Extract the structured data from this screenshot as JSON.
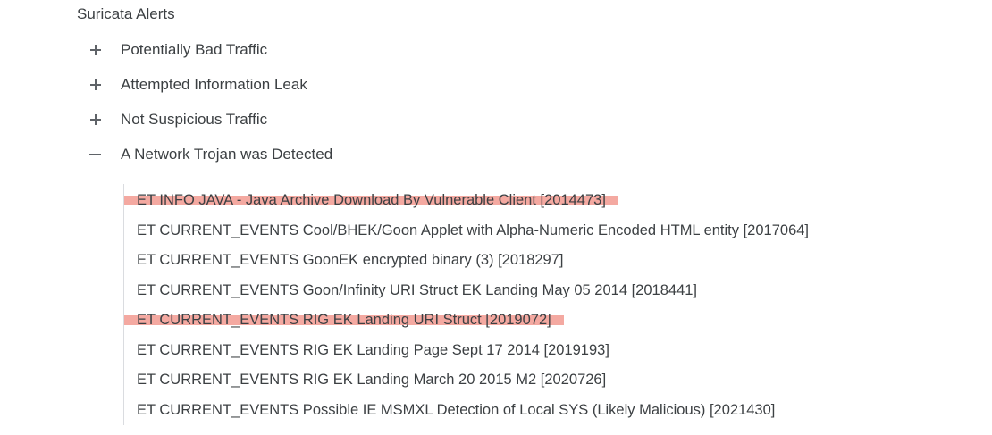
{
  "title": "Suricata Alerts",
  "categories": [
    {
      "label": "Potentially Bad Traffic",
      "state": "collapsed",
      "icon": "plus-icon"
    },
    {
      "label": "Attempted Information Leak",
      "state": "collapsed",
      "icon": "plus-icon"
    },
    {
      "label": "Not Suspicious Traffic",
      "state": "collapsed",
      "icon": "plus-icon"
    },
    {
      "label": "A Network Trojan was Detected",
      "state": "expanded",
      "icon": "minus-icon"
    }
  ],
  "alerts": [
    {
      "text": "ET INFO JAVA - Java Archive Download By Vulnerable Client [2014473]",
      "highlighted": true
    },
    {
      "text": "ET CURRENT_EVENTS Cool/BHEK/Goon Applet with Alpha-Numeric Encoded HTML entity [2017064]",
      "highlighted": false
    },
    {
      "text": "ET CURRENT_EVENTS GoonEK encrypted binary (3) [2018297]",
      "highlighted": false
    },
    {
      "text": "ET CURRENT_EVENTS Goon/Infinity URI Struct EK Landing May 05 2014 [2018441]",
      "highlighted": false
    },
    {
      "text": "ET CURRENT_EVENTS RIG EK Landing URI Struct [2019072]",
      "highlighted": true
    },
    {
      "text": "ET CURRENT_EVENTS RIG EK Landing Page Sept 17 2014 [2019193]",
      "highlighted": false
    },
    {
      "text": "ET CURRENT_EVENTS RIG EK Landing March 20 2015 M2 [2020726]",
      "highlighted": false
    },
    {
      "text": "ET CURRENT_EVENTS Possible IE MSMXL Detection of Local SYS (Likely Malicious) [2021430]",
      "highlighted": false
    }
  ],
  "colors": {
    "highlight": "#f4a9a1",
    "text": "#3c4043"
  }
}
